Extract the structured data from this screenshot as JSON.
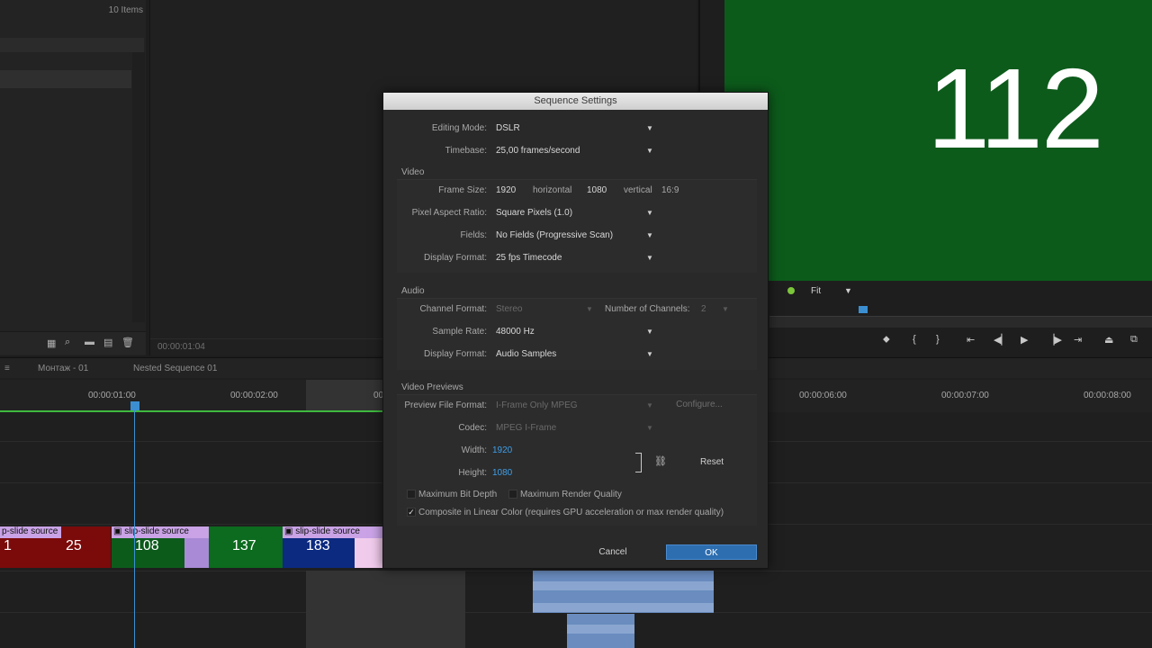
{
  "project": {
    "item_count": "10 Items"
  },
  "source": {
    "timecode": "00:00:01:04"
  },
  "program": {
    "frame_number": "112",
    "zoom": "Fit"
  },
  "timeline": {
    "tabs": [
      "Монтаж - 01",
      "Nested Sequence 01"
    ],
    "ruler": [
      "00:00:01:00",
      "00:00:02:00",
      "00",
      "00:00:06:00",
      "00:00:07:00",
      "00:00:08:00"
    ],
    "clips": [
      {
        "label": "p-slide source",
        "num_left": "1",
        "num_right": "25",
        "color": "#7b0a0a"
      },
      {
        "label": "slip-slide source",
        "num": "108",
        "color": "#0c5b1b"
      },
      {
        "label": "",
        "num": "137",
        "color": "#0c6b1e"
      },
      {
        "label": "slip-slide source",
        "num": "183",
        "color": "#0b2a80"
      }
    ]
  },
  "dialog": {
    "title": "Sequence Settings",
    "editing_mode_label": "Editing Mode:",
    "editing_mode_value": "DSLR",
    "timebase_label": "Timebase:",
    "timebase_value": "25,00 frames/second",
    "video_section": "Video",
    "frame_size_label": "Frame Size:",
    "frame_width": "1920",
    "horizontal_label": "horizontal",
    "frame_height": "1080",
    "vertical_label": "vertical",
    "aspect": "16:9",
    "par_label": "Pixel Aspect Ratio:",
    "par_value": "Square Pixels (1.0)",
    "fields_label": "Fields:",
    "fields_value": "No Fields (Progressive Scan)",
    "vdisplay_label": "Display Format:",
    "vdisplay_value": "25 fps Timecode",
    "audio_section": "Audio",
    "channel_format_label": "Channel Format:",
    "channel_format_value": "Stereo",
    "num_channels_label": "Number of Channels:",
    "num_channels_value": "2",
    "sample_rate_label": "Sample Rate:",
    "sample_rate_value": "48000 Hz",
    "adisplay_label": "Display Format:",
    "adisplay_value": "Audio Samples",
    "previews_section": "Video Previews",
    "preview_format_label": "Preview File Format:",
    "preview_format_value": "I-Frame Only MPEG",
    "configure_label": "Configure...",
    "codec_label": "Codec:",
    "codec_value": "MPEG I-Frame",
    "width_label": "Width:",
    "width_value": "1920",
    "height_label": "Height:",
    "height_value": "1080",
    "reset_label": "Reset",
    "max_bit_depth_label": "Maximum Bit Depth",
    "max_render_label": "Maximum Render Quality",
    "composite_label": "Composite in Linear Color (requires GPU acceleration or max render quality)",
    "composite_checked": true,
    "cancel_label": "Cancel",
    "ok_label": "OK",
    "ok_color": "#2d6eb0"
  }
}
